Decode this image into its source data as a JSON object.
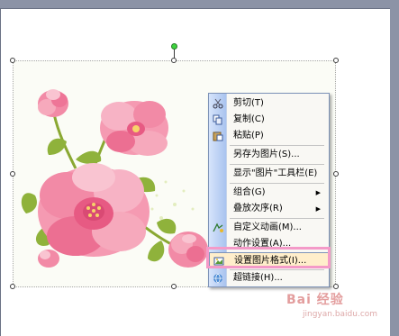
{
  "context_menu": {
    "items": [
      {
        "label": "剪切(T)",
        "icon": "scissors-icon"
      },
      {
        "label": "复制(C)",
        "icon": "copy-icon"
      },
      {
        "label": "粘贴(P)",
        "icon": "paste-icon"
      },
      {
        "label": "另存为图片(S)...",
        "icon": ""
      },
      {
        "label": "显示\"图片\"工具栏(E)",
        "icon": ""
      },
      {
        "label": "组合(G)",
        "icon": "",
        "submenu": true
      },
      {
        "label": "叠放次序(R)",
        "icon": "",
        "submenu": true
      },
      {
        "label": "自定义动画(M)...",
        "icon": "animation-icon"
      },
      {
        "label": "动作设置(A)...",
        "icon": ""
      },
      {
        "label": "设置图片格式(I)...",
        "icon": "format-picture-icon",
        "highlighted": true
      },
      {
        "label": "超链接(H)...",
        "icon": "hyperlink-icon"
      }
    ],
    "submenu_arrow": "▶"
  },
  "watermark": {
    "text": "Bai 经验",
    "url": "jingyan.baidu.com"
  },
  "colors": {
    "workspace": "#8c93a6",
    "menu_strip": "#a9c3ef",
    "highlight_fill": "#ffeecb",
    "annotation_box": "#f49ac8"
  }
}
